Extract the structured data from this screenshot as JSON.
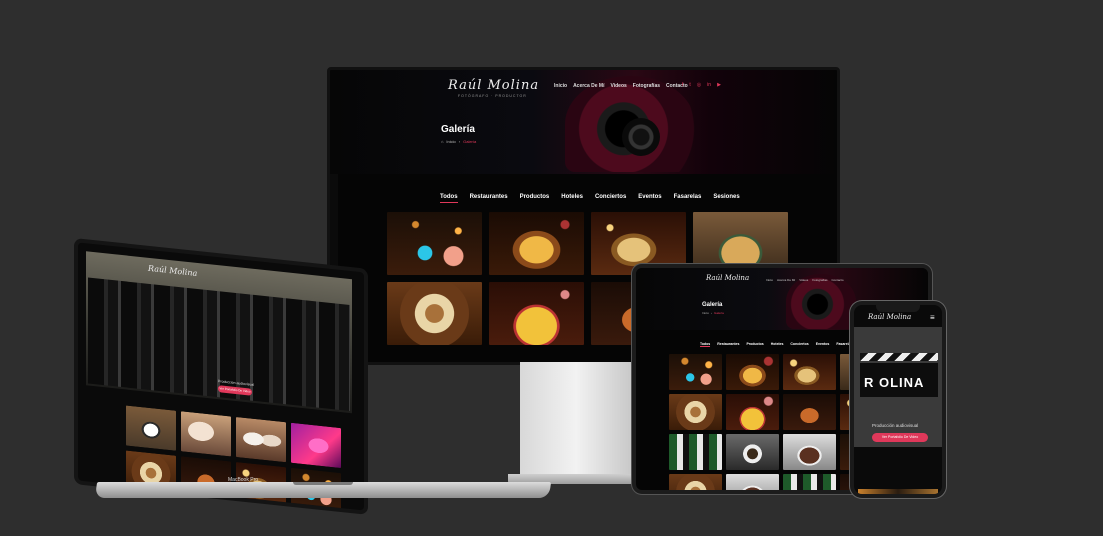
{
  "desktop": {
    "logo": "Raúl Molina",
    "logo_sub": "FOTÓGRAFO · PRODUCTOR",
    "nav": [
      "Inicio",
      "Acerca De Mí",
      "Videos",
      "Fotografías",
      "Contacto"
    ],
    "social_icons": [
      "facebook-icon",
      "twitter-icon",
      "instagram-icon",
      "linkedin-icon",
      "youtube-icon"
    ],
    "page_title": "Galería",
    "breadcrumb": {
      "home": "Inicio",
      "sep": "›",
      "current": "Galería"
    },
    "filters": [
      "Todos",
      "Restaurantes",
      "Productos",
      "Hoteles",
      "Conciertos",
      "Eventos",
      "Fasarelas",
      "Sesiones"
    ],
    "active_filter": "Todos",
    "gallery": [
      "drinks",
      "nachos",
      "tacos",
      "platter",
      "plate",
      "fries",
      "dish"
    ]
  },
  "laptop": {
    "logo": "Raúl Molina",
    "caption": "Producción audiovisual",
    "button": "Ver Portafolio De Video",
    "brand": "MacBook Pro",
    "gallery": [
      "sushi",
      "bride",
      "brides",
      "pink",
      "plate",
      "dish",
      "tacos",
      "drinks"
    ]
  },
  "tablet": {
    "logo": "Raúl Molina",
    "nav": [
      "Inicio",
      "Acerca De Mí",
      "Videos",
      "Fotografías",
      "Contacto"
    ],
    "page_title": "Galería",
    "breadcrumb": {
      "home": "Inicio",
      "sep": "›",
      "current": "Galería"
    },
    "filters": [
      "Todos",
      "Restaurantes",
      "Productos",
      "Hoteles",
      "Conciertos",
      "Eventos",
      "Fasarelas"
    ],
    "gallery": [
      "drinks",
      "nachos",
      "tacos",
      "platter",
      "plate",
      "fries",
      "dish",
      "tacos",
      "cans",
      "coffee",
      "cake",
      "drinks",
      "plate",
      "cake",
      "cans",
      "dish"
    ]
  },
  "phone": {
    "logo": "Raúl Molina",
    "hero_text": "R  OLINA",
    "caption": "Producción audiovisual",
    "button": "Ver Portafolio De Video"
  },
  "colors": {
    "accent": "#e0385a",
    "background": "#2e2e2e"
  }
}
